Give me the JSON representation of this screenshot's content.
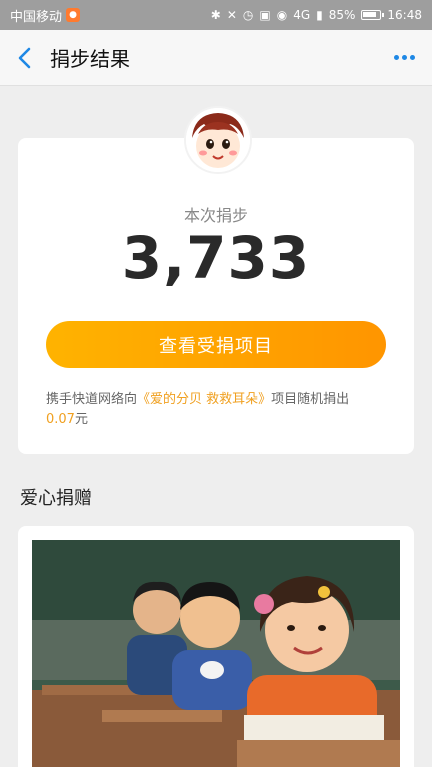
{
  "status_bar": {
    "carrier": "中国移动",
    "battery": "85%",
    "time": "16:48",
    "network": "4G"
  },
  "nav": {
    "title": "捐步结果"
  },
  "result": {
    "label": "本次捐步",
    "steps": "3,733",
    "button_label": "查看受捐项目",
    "desc_prefix": "携手快道网络向",
    "project_name": "《爱的分贝 救救耳朵》",
    "desc_suffix": "项目随机捐出",
    "amount": "0.07",
    "amount_unit": "元"
  },
  "section": {
    "title": "爱心捐赠"
  },
  "colors": {
    "accent_blue": "#1e88e5",
    "button_orange": "#ff9f00",
    "highlight": "#f0a020"
  }
}
